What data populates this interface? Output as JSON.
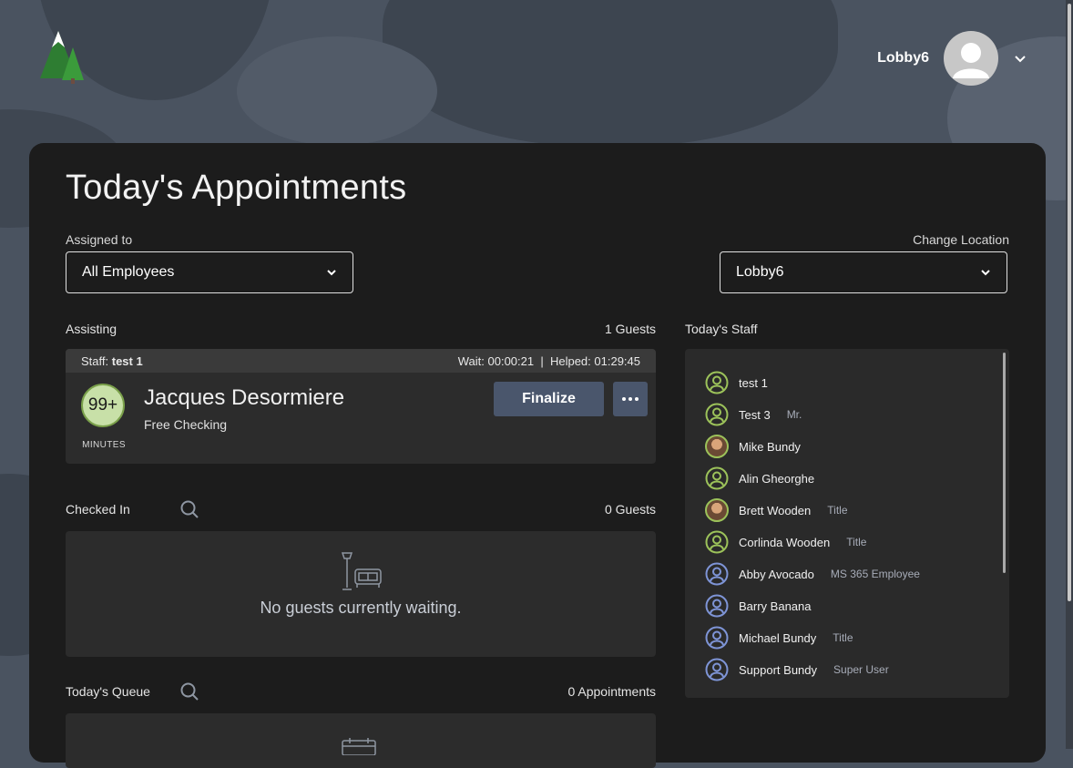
{
  "header": {
    "user_name": "Lobby6",
    "logo_icon": "pine-tree-logo-icon",
    "avatar_icon": "user-avatar-icon",
    "menu_icon": "chevron-down-icon"
  },
  "page": {
    "title": "Today's Appointments"
  },
  "filters": {
    "assigned_label": "Assigned to",
    "assigned_value": "All Employees",
    "location_label": "Change Location",
    "location_value": "Lobby6"
  },
  "assisting": {
    "label": "Assisting",
    "count": "1 Guests",
    "staff_label": "Staff:",
    "staff_name": "test 1",
    "wait": "Wait: 00:00:21",
    "separator": "|",
    "helped": "Helped: 01:29:45",
    "wait_value": "99+",
    "wait_unit": "MINUTES",
    "guest_name": "Jacques Desormiere",
    "service": "Free Checking",
    "finalize_label": "Finalize",
    "more_icon": "more-dots-icon"
  },
  "checked_in": {
    "label": "Checked In",
    "count": "0 Guests",
    "empty_message": "No guests currently waiting.",
    "empty_icon": "couch-lamp-icon"
  },
  "queue": {
    "label": "Today's Queue",
    "count": "0 Appointments",
    "empty_icon": "calendar-icon"
  },
  "staff": {
    "label": "Today's Staff",
    "items": [
      {
        "name": "test 1",
        "title": "",
        "avatar": "user-outline-green"
      },
      {
        "name": "Test 3",
        "title": "Mr.",
        "avatar": "user-outline-green"
      },
      {
        "name": "Mike Bundy",
        "title": "",
        "avatar": "photo"
      },
      {
        "name": "Alin Gheorghe",
        "title": "",
        "avatar": "user-outline-green"
      },
      {
        "name": "Brett Wooden",
        "title": "Title",
        "avatar": "photo"
      },
      {
        "name": "Corlinda Wooden",
        "title": "Title",
        "avatar": "user-outline-green"
      },
      {
        "name": "Abby Avocado",
        "title": "MS 365 Employee",
        "avatar": "user-outline-blue"
      },
      {
        "name": "Barry Banana",
        "title": "",
        "avatar": "user-outline-blue"
      },
      {
        "name": "Michael Bundy",
        "title": "Title",
        "avatar": "user-outline-blue"
      },
      {
        "name": "Support Bundy",
        "title": "Super User",
        "avatar": "user-outline-blue"
      }
    ]
  },
  "colors": {
    "background": "#4a5360",
    "card": "#1c1c1c",
    "button": "#4a566c",
    "available_green": "#9cc25a",
    "offline_blue": "#7e94d6"
  }
}
